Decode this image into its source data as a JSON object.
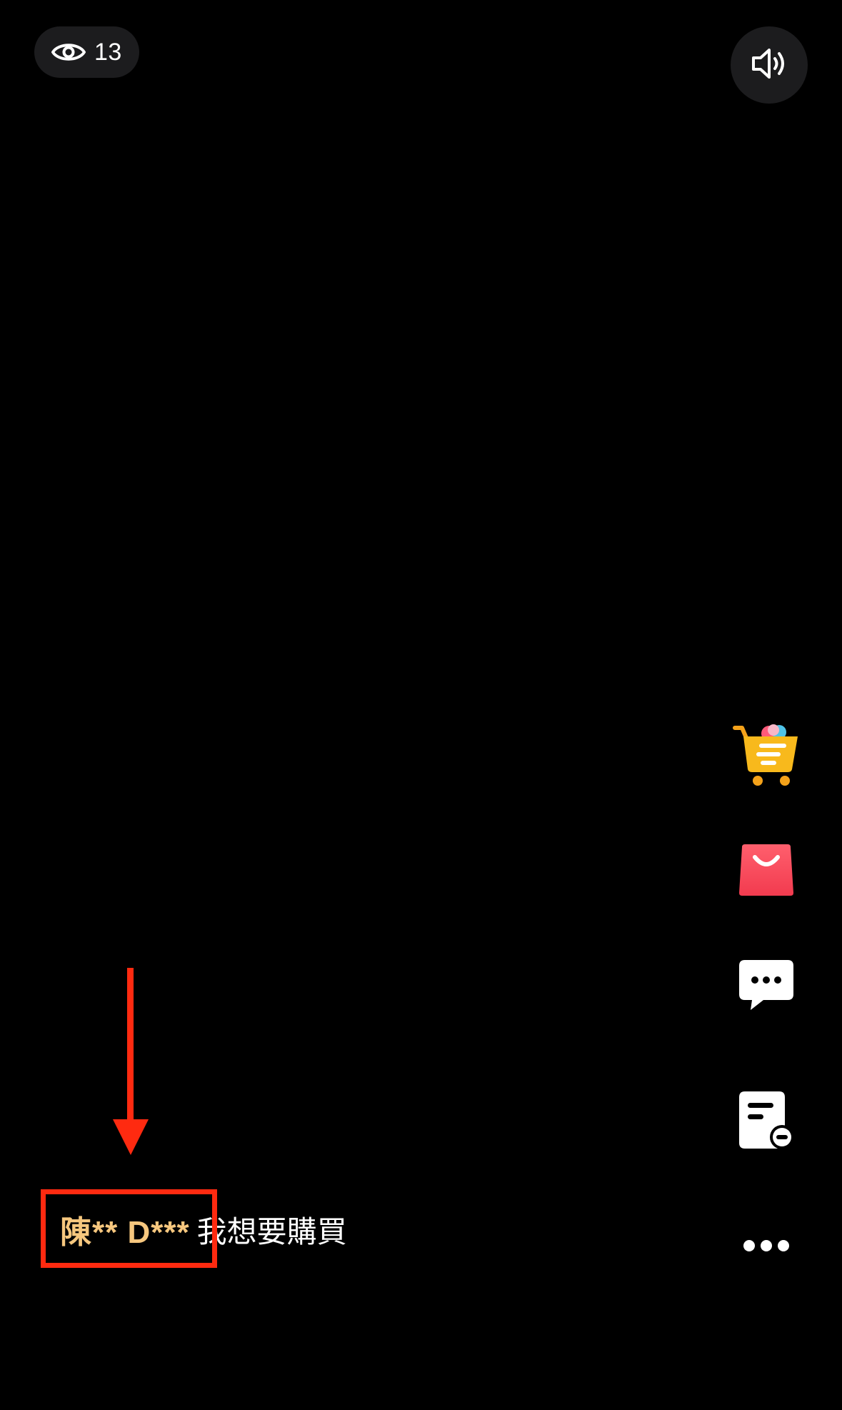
{
  "header": {
    "viewer_count": "13",
    "viewer_icon": "eye-icon",
    "sound_icon": "speaker-icon"
  },
  "side_actions": [
    {
      "name": "shopping-cart",
      "icon": "shopping-cart-icon"
    },
    {
      "name": "shopping-bag",
      "icon": "shopping-bag-icon"
    },
    {
      "name": "chat",
      "icon": "chat-bubble-icon"
    },
    {
      "name": "order-list",
      "icon": "document-list-icon"
    },
    {
      "name": "more",
      "icon": "more-dots-icon"
    }
  ],
  "comment": {
    "username": "陳** D***",
    "message": "我想要購買"
  },
  "annotation": {
    "highlight_color": "#ff2a10",
    "username_color": "#f6c77e"
  }
}
